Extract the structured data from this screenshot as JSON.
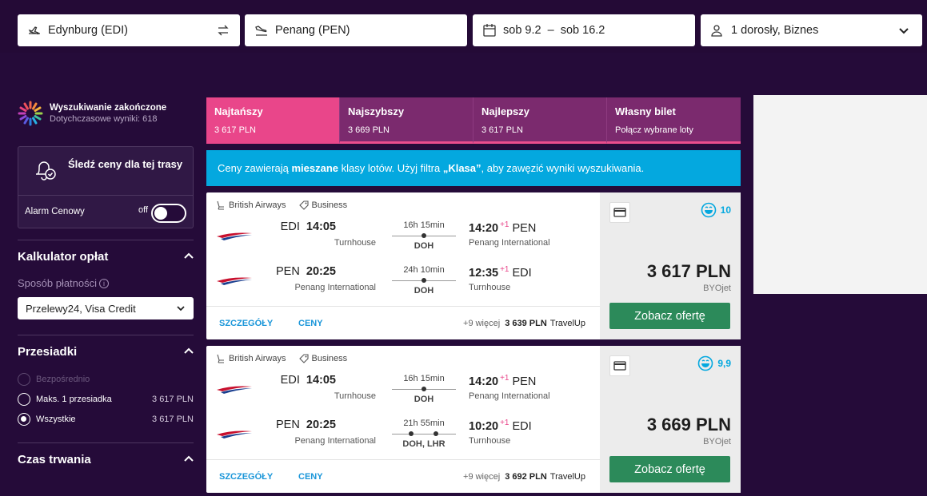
{
  "search": {
    "from": "Edynburg (EDI)",
    "to": "Penang (PEN)",
    "dates": "sob 9.2  –  sob 16.2",
    "passengers": "1 dorosły, Biznes"
  },
  "sidebar": {
    "status_title": "Wyszukiwanie zakończone",
    "status_sub": "Dotychczasowe wyniki: 618",
    "track_title": "Śledź ceny dla tej trasy",
    "alarm_label": "Alarm Cenowy",
    "toggle_label": "off",
    "fees_title": "Kalkulator opłat",
    "payment_label": "Sposób płatności",
    "payment_value": "Przelewy24, Visa Credit",
    "stops_title": "Przesiadki",
    "stops": [
      {
        "label": "Bezpośrednio",
        "price": ""
      },
      {
        "label": "Maks. 1 przesiadka",
        "price": "3 617 PLN"
      },
      {
        "label": "Wszystkie",
        "price": "3 617 PLN"
      }
    ],
    "duration_title": "Czas trwania"
  },
  "tabs": [
    {
      "name": "Najtańszy",
      "price": "3 617 PLN"
    },
    {
      "name": "Najszybszy",
      "price": "3 669 PLN"
    },
    {
      "name": "Najlepszy",
      "price": "3 617 PLN"
    },
    {
      "name": "Własny bilet",
      "price": "Połącz wybrane loty"
    }
  ],
  "notice": {
    "pre": "Ceny zawierają ",
    "bold1": "mieszane",
    "mid": " klasy lotów. Użyj filtra ",
    "bold2": "„Klasa”",
    "post": ", aby zawęzić wyniki wyszukiwania."
  },
  "cards": [
    {
      "airline": "British Airways",
      "cabin": "Business",
      "legs": [
        {
          "dep_code": "EDI",
          "dep_time": "14:05",
          "dep_name": "Turnhouse",
          "duration": "16h 15min",
          "via": "DOH",
          "arr_time": "14:20",
          "plus": "+1",
          "arr_code": "PEN",
          "arr_name": "Penang International"
        },
        {
          "dep_code": "PEN",
          "dep_time": "20:25",
          "dep_name": "Penang International",
          "duration": "24h 10min",
          "via": "DOH",
          "arr_time": "12:35",
          "plus": "+1",
          "arr_code": "EDI",
          "arr_name": "Turnhouse"
        }
      ],
      "details": "SZCZEGÓŁY",
      "prices_link": "CENY",
      "more": "+9 więcej",
      "alt_price": "3 639 PLN",
      "alt_agent": "TravelUp",
      "score": "10",
      "price": "3 617 PLN",
      "provider": "BYOjet",
      "cta": "Zobacz ofertę"
    },
    {
      "airline": "British Airways",
      "cabin": "Business",
      "legs": [
        {
          "dep_code": "EDI",
          "dep_time": "14:05",
          "dep_name": "Turnhouse",
          "duration": "16h 15min",
          "via": "DOH",
          "arr_time": "14:20",
          "plus": "+1",
          "arr_code": "PEN",
          "arr_name": "Penang International"
        },
        {
          "dep_code": "PEN",
          "dep_time": "20:25",
          "dep_name": "Penang International",
          "duration": "21h 55min",
          "via": "DOH, LHR",
          "arr_time": "10:20",
          "plus": "+1",
          "arr_code": "EDI",
          "arr_name": "Turnhouse"
        }
      ],
      "details": "SZCZEGÓŁY",
      "prices_link": "CENY",
      "more": "+9 więcej",
      "alt_price": "3 692 PLN",
      "alt_agent": "TravelUp",
      "score": "9,9",
      "price": "3 669 PLN",
      "provider": "BYOjet",
      "cta": "Zobacz ofertę"
    }
  ]
}
